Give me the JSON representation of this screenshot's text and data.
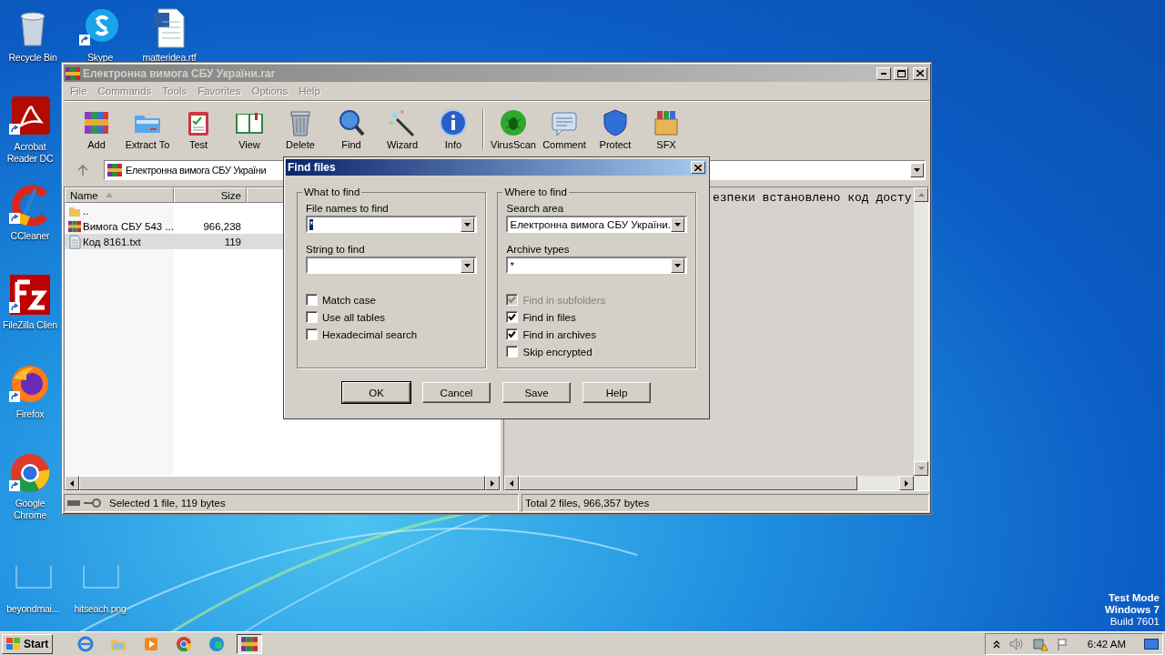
{
  "desktop_icons": [
    {
      "label": "Recycle Bin"
    },
    {
      "label": "Skype"
    },
    {
      "label": "matteridea.rtf"
    },
    {
      "label": "Acrobat Reader DC"
    },
    {
      "label": "CCleaner"
    },
    {
      "label": "FileZilla Clien"
    },
    {
      "label": "Firefox"
    },
    {
      "label": "Google Chrome"
    },
    {
      "label": "beyondmai..."
    },
    {
      "label": "hitseach.png"
    }
  ],
  "window": {
    "title": "Електронна вимога СБУ України.rar",
    "active": false,
    "menu": [
      {
        "label": "File",
        "disabled": true
      },
      {
        "label": "Commands",
        "disabled": true
      },
      {
        "label": "Tools",
        "disabled": true
      },
      {
        "label": "Favorites",
        "disabled": true
      },
      {
        "label": "Options",
        "disabled": true
      },
      {
        "label": "Help",
        "disabled": true
      }
    ],
    "toolbar": [
      {
        "label": "Add"
      },
      {
        "label": "Extract To"
      },
      {
        "label": "Test"
      },
      {
        "label": "View"
      },
      {
        "label": "Delete"
      },
      {
        "label": "Find"
      },
      {
        "label": "Wizard"
      },
      {
        "label": "Info"
      },
      {
        "label": "VirusScan"
      },
      {
        "label": "Comment"
      },
      {
        "label": "Protect"
      },
      {
        "label": "SFX"
      }
    ],
    "address": "Електронна вимога СБУ України",
    "columns": [
      "Name",
      "Size"
    ],
    "files": [
      {
        "kind": "parent",
        "name": "..",
        "selected": false
      },
      {
        "kind": "archive",
        "name": "Вимога СБУ 543 ...",
        "size": "966,238",
        "selected": false
      },
      {
        "kind": "text",
        "name": "Код 8161.txt",
        "size": "119",
        "selected": true
      }
    ],
    "viewer_text": "езпеки встановлено код досту",
    "status_left": "Selected 1 file, 119 bytes",
    "status_right": "Total 2 files, 966,357 bytes"
  },
  "find_dialog": {
    "title": "Find files",
    "groups": [
      {
        "legend": "What to find",
        "fields": [
          {
            "label": "File names to find",
            "value": "*",
            "value_selected": true
          },
          {
            "label": "String to find"
          }
        ],
        "options": [
          {
            "label": "Match case",
            "checked": false,
            "disabled": false
          },
          {
            "label": "Use all tables",
            "checked": false,
            "disabled": false
          },
          {
            "label": "Hexadecimal search",
            "checked": false,
            "disabled": false
          }
        ]
      },
      {
        "legend": "Where to find",
        "fields": [
          {
            "label": "Search area",
            "value": "Електронна вимога СБУ України.",
            "value_selected": false
          },
          {
            "label": "Archive types",
            "value": "*",
            "value_selected": false
          }
        ],
        "options": [
          {
            "label": "Find in subfolders",
            "checked": true,
            "disabled": true
          },
          {
            "label": "Find in files",
            "checked": true,
            "disabled": false
          },
          {
            "label": "Find in archives",
            "checked": true,
            "disabled": false
          },
          {
            "label": "Skip encrypted",
            "checked": false,
            "disabled": false
          }
        ]
      }
    ],
    "buttons": [
      {
        "label": "OK",
        "default": true
      },
      {
        "label": "Cancel",
        "default": false
      },
      {
        "label": "Save",
        "default": false
      },
      {
        "label": "Help",
        "default": false
      }
    ]
  },
  "os_notice": [
    "Test Mode",
    "Windows 7",
    "Build 7601"
  ],
  "taskbar": {
    "start": "Start",
    "apps": [
      {
        "active": false
      },
      {
        "active": false
      },
      {
        "active": false
      },
      {
        "active": false
      },
      {
        "active": false
      },
      {
        "active": true
      }
    ],
    "time": "6:42 AM"
  }
}
